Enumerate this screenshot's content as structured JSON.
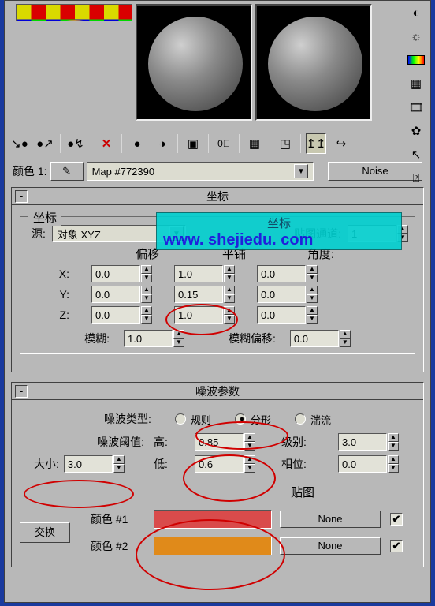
{
  "name_row": {
    "label": "颜色 1:",
    "map_name": "Map #772390",
    "noise_button": "Noise"
  },
  "watermark": {
    "line1": "坐标",
    "line2": "www. shejiedu. com"
  },
  "coord": {
    "title": "坐标",
    "legend": "坐标",
    "source_label": "源:",
    "source_value": "对象 XYZ",
    "channel_label": "贴图通道:",
    "channel_value": "1",
    "cols": {
      "offset": "偏移",
      "tiling": "平铺",
      "angle": "角度:"
    },
    "axes": {
      "x": "X:",
      "y": "Y:",
      "z": "Z:"
    },
    "values": {
      "offset_x": "0.0",
      "offset_y": "0.0",
      "offset_z": "0.0",
      "tiling_x": "1.0",
      "tiling_y": "0.15",
      "tiling_z": "1.0",
      "angle_x": "0.0",
      "angle_y": "0.0",
      "angle_z": "0.0"
    },
    "blur_label": "模糊:",
    "blur_value": "1.0",
    "blur_offset_label": "模糊偏移:",
    "blur_offset_value": "0.0"
  },
  "noise": {
    "title": "噪波参数",
    "type_label": "噪波类型:",
    "types": {
      "regular": "规则",
      "fractal": "分形",
      "turb": "湍流"
    },
    "type_selected": "fractal",
    "threshold_label": "噪波阈值:",
    "high_label": "高:",
    "high_value": "0.85",
    "low_label": "低:",
    "low_value": "0.6",
    "levels_label": "级别:",
    "levels_value": "3.0",
    "phase_label": "相位:",
    "phase_value": "0.0",
    "size_label": "大小:",
    "size_value": "3.0",
    "maps_header": "贴图",
    "swap_label": "交换",
    "color1_label": "颜色 #1",
    "color2_label": "颜色 #2",
    "color1_hex": "#d94b4b",
    "color2_hex": "#e08a1a",
    "none_label": "None"
  }
}
